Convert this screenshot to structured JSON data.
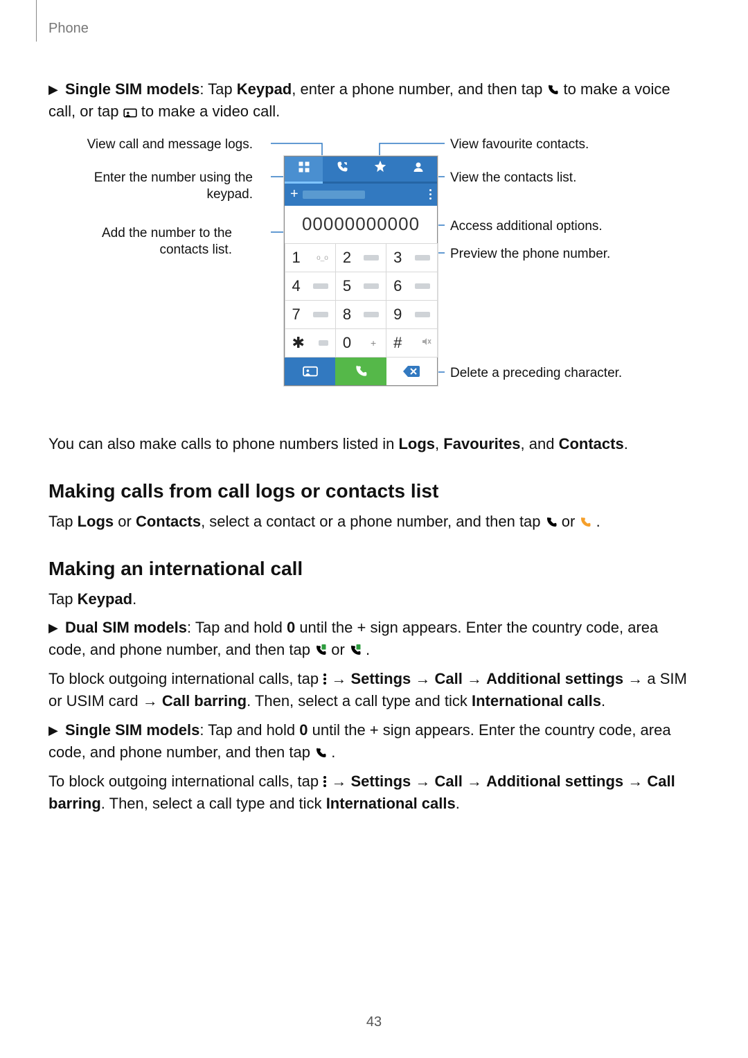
{
  "header": {
    "title": "Phone"
  },
  "page_number": "43",
  "intro": {
    "pre_bold": "Single SIM models",
    "mid1": ": Tap ",
    "kw_keypad": "Keypad",
    "mid2": ", enter a phone number, and then tap ",
    "mid3": " to make a voice call, or tap ",
    "mid4": " to make a video call."
  },
  "diagram": {
    "left_callouts": {
      "logs": "View call and message logs.",
      "keypad": "Enter the number using the keypad.",
      "add_contact": "Add the number to the contacts list."
    },
    "right_callouts": {
      "favourites": "View favourite contacts.",
      "contacts_list": "View the contacts list.",
      "more_options": "Access additional options.",
      "preview_number": "Preview the phone number.",
      "delete_char": "Delete a preceding character."
    },
    "display_number": "00000000000",
    "keys": [
      {
        "main": "1",
        "sub": "qo"
      },
      {
        "main": "2",
        "sub": "blur"
      },
      {
        "main": "3",
        "sub": "blur"
      },
      {
        "main": "4",
        "sub": "blur"
      },
      {
        "main": "5",
        "sub": "blur"
      },
      {
        "main": "6",
        "sub": "blur"
      },
      {
        "main": "7",
        "sub": "blur"
      },
      {
        "main": "8",
        "sub": "blur"
      },
      {
        "main": "9",
        "sub": "blur"
      },
      {
        "main": "✱",
        "sub": "tiny"
      },
      {
        "main": "0",
        "sub": "plus"
      },
      {
        "main": "#",
        "sub": "mute"
      }
    ]
  },
  "after_diagram": {
    "p1_pre": "You can also make calls to phone numbers listed in ",
    "p1_logs": "Logs",
    "p1_c1": ", ",
    "p1_fav": "Favourites",
    "p1_c2": ", and ",
    "p1_contacts": "Contacts",
    "p1_end": "."
  },
  "section_logs": {
    "heading": "Making calls from call logs or contacts list",
    "p_pre": "Tap ",
    "p_logs": "Logs",
    "p_mid1": " or ",
    "p_contacts": "Contacts",
    "p_mid2": ", select a contact or a phone number, and then tap ",
    "p_mid3": " or ",
    "p_end": "."
  },
  "section_intl": {
    "heading": "Making an international call",
    "tap_keypad_pre": "Tap ",
    "tap_keypad": "Keypad",
    "tap_keypad_end": ".",
    "dual_label": "Dual SIM models",
    "dual_p1_a": ": Tap and hold ",
    "dual_zero": "0",
    "dual_p1_b": " until the + sign appears. Enter the country code, area code, and phone number, and then tap ",
    "dual_or": " or ",
    "dual_end": ".",
    "block1_a": "To block outgoing international calls, tap ",
    "arrow": " → ",
    "settings": "Settings",
    "call": "Call",
    "addl": "Additional settings",
    "block1_b": " a SIM or USIM card → ",
    "call_barring": "Call barring",
    "block1_c": ". Then, select a call type and tick ",
    "intl_calls": "International calls",
    "period": ".",
    "single_label": "Single SIM models",
    "single_p1_a": ": Tap and hold ",
    "single_p1_b": " until the + sign appears. Enter the country code, area code, and phone number, and then tap ",
    "block2_a": "To block outgoing international calls, tap ",
    "block2_b": " → "
  }
}
